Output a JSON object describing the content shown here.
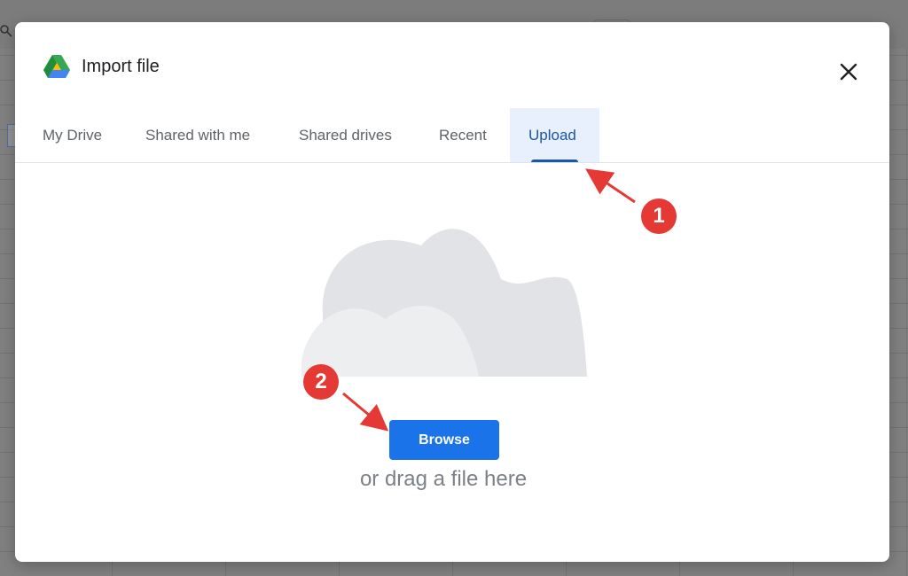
{
  "dialog": {
    "title": "Import file",
    "logo_icon": "google-drive-logo",
    "close_icon": "close-icon"
  },
  "tabs": [
    {
      "label": "My Drive",
      "active": false
    },
    {
      "label": "Shared with me",
      "active": false
    },
    {
      "label": "Shared drives",
      "active": false
    },
    {
      "label": "Recent",
      "active": false
    },
    {
      "label": "Upload",
      "active": true
    }
  ],
  "upload": {
    "illustration_icon": "cloud-illustration",
    "browse_label": "Browse",
    "drag_text": "or drag a file here"
  },
  "annotations": {
    "callout_1": "1",
    "callout_2": "2"
  },
  "colors": {
    "accent": "#1a73e8",
    "active_tab_bg": "#e8f0fe",
    "active_tab_text": "#1a57a6",
    "callout": "#e53935"
  }
}
